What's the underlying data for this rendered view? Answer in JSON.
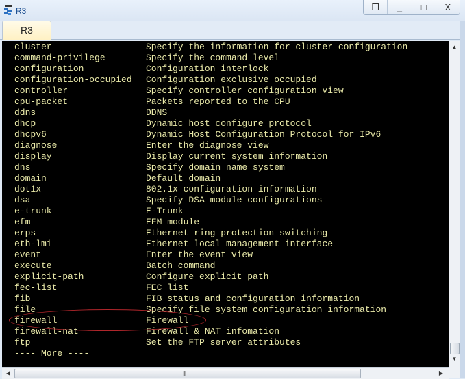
{
  "window": {
    "title": "R3",
    "controls": {
      "restore_label": "❐",
      "minimize_label": "_",
      "maximize_label": "□",
      "close_label": "X"
    }
  },
  "tabs": [
    {
      "label": "R3",
      "active": true
    }
  ],
  "terminal": {
    "text_color": "#e8e8a8",
    "background": "#000000",
    "lines": [
      {
        "cmd": "cluster",
        "desc": "Specify the information for cluster configuration"
      },
      {
        "cmd": "command-privilege",
        "desc": "Specify the command level"
      },
      {
        "cmd": "configuration",
        "desc": "Configuration interlock"
      },
      {
        "cmd": "configuration-occupied",
        "desc": "Configuration exclusive occupied"
      },
      {
        "cmd": "controller",
        "desc": "Specify controller configuration view"
      },
      {
        "cmd": "cpu-packet",
        "desc": "Packets reported to the CPU"
      },
      {
        "cmd": "ddns",
        "desc": "DDNS"
      },
      {
        "cmd": "dhcp",
        "desc": "Dynamic host configure protocol"
      },
      {
        "cmd": "dhcpv6",
        "desc": "Dynamic Host Configuration Protocol for IPv6"
      },
      {
        "cmd": "diagnose",
        "desc": "Enter the diagnose view"
      },
      {
        "cmd": "display",
        "desc": "Display current system information"
      },
      {
        "cmd": "dns",
        "desc": "Specify domain name system"
      },
      {
        "cmd": "domain",
        "desc": "Default domain"
      },
      {
        "cmd": "dot1x",
        "desc": "802.1x configuration information"
      },
      {
        "cmd": "dsa",
        "desc": "Specify DSA module configurations"
      },
      {
        "cmd": "e-trunk",
        "desc": "E-Trunk"
      },
      {
        "cmd": "efm",
        "desc": "EFM module"
      },
      {
        "cmd": "erps",
        "desc": "Ethernet ring protection switching"
      },
      {
        "cmd": "eth-lmi",
        "desc": "Ethernet local management interface"
      },
      {
        "cmd": "event",
        "desc": "Enter the event view"
      },
      {
        "cmd": "execute",
        "desc": "Batch command"
      },
      {
        "cmd": "explicit-path",
        "desc": "Configure explicit path"
      },
      {
        "cmd": "fec-list",
        "desc": "FEC list"
      },
      {
        "cmd": "fib",
        "desc": "FIB status and configuration information"
      },
      {
        "cmd": "file",
        "desc": "Specify file system configuration information"
      },
      {
        "cmd": "firewall",
        "desc": "Firewall",
        "highlighted": true
      },
      {
        "cmd": "firewall-nat",
        "desc": "Firewall & NAT infomation"
      },
      {
        "cmd": "ftp",
        "desc": "Set the FTP server attributes"
      },
      {
        "cmd": "---- More ----",
        "desc": ""
      }
    ],
    "highlight_color": "#b0262b"
  },
  "scrollbars": {
    "vertical": {
      "position_fraction": 1.0,
      "up_icon": "▲",
      "down_icon": "▼"
    },
    "horizontal": {
      "position_fraction": 0.0,
      "left_icon": "◀",
      "right_icon": "▶",
      "grip": "III"
    }
  }
}
